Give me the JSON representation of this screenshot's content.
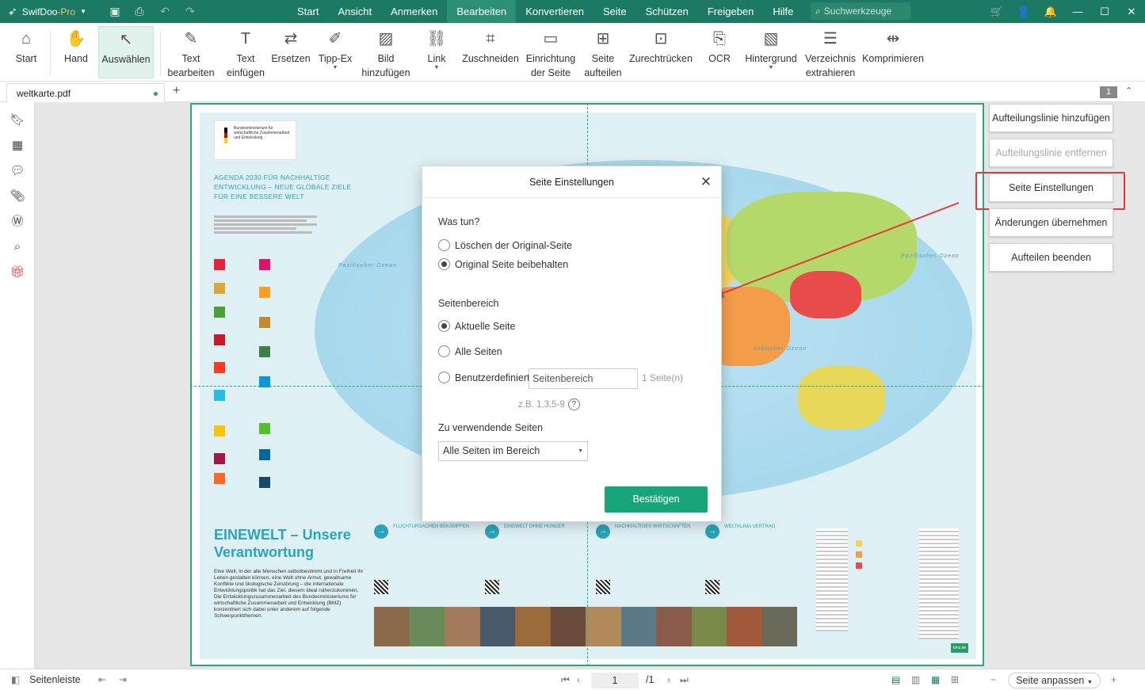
{
  "app": {
    "name": "SwifDoo",
    "suffix": "-Pro"
  },
  "menu": [
    "Start",
    "Ansicht",
    "Anmerken",
    "Bearbeiten",
    "Konvertieren",
    "Seite",
    "Schützen",
    "Freigeben",
    "Hilfe"
  ],
  "menu_active": "Bearbeiten",
  "search_placeholder": "Suchwerkzeuge",
  "ribbon": {
    "start": "Start",
    "hand": "Hand",
    "select": "Auswählen",
    "edit_text_1": "Text",
    "edit_text_2": "bearbeiten",
    "add_text_1": "Text",
    "add_text_2": "einfügen",
    "replace": "Ersetzen",
    "tippex": "Tipp-Ex",
    "add_image_1": "Bild",
    "add_image_2": "hinzufügen",
    "link": "Link",
    "crop": "Zuschneiden",
    "page_setup_1": "Einrichtung",
    "page_setup_2": "der Seite",
    "split_page_1": "Seite",
    "split_page_2": "aufteilen",
    "deskew": "Zurechtrücken",
    "ocr": "OCR",
    "background": "Hintergrund",
    "extract_dir_1": "Verzeichnis",
    "extract_dir_2": "extrahieren",
    "compress": "Komprimieren"
  },
  "tab": {
    "filename": "weltkarte.pdf",
    "page_badge": "1"
  },
  "poster": {
    "gov": "Bundesministerium für wirtschaftliche Zusammenarbeit und Entwicklung",
    "agenda_1": "AGENDA 2030 FÜR NACHHALTIGE",
    "agenda_2": "ENTWICKLUNG – NEUE GLOBALE ZIELE",
    "agenda_3": "FÜR EINE BESSERE WELT",
    "title_1": "EINEWELT – Unsere",
    "title_2": "Verantwortung",
    "body": "Eine Welt, in der alle Menschen selbstbestimmt und in Freiheit ihr Leben gestalten können, eine Welt ohne Armut, gewaltsame Konflikte und ökologische Zerstörung – die internationale Entwicklungspolitik hat das Ziel, diesem Ideal näherzukommen. Die Entwicklungszusammenarbeit des Bundesministeriums für wirtschaftliche Zusammenarbeit und Entwicklung (BMZ) konzentriert sich dabei unter anderem auf folgende Schwerpunktthemen:",
    "col1": "FLUCHTURSACHEN BEKÄMPFEN",
    "col2": "EINEWELT OHNE HUNGER",
    "col3": "NACHHALTIGES WIRTSCHAFTEN",
    "col4": "WELTKLIMA VERTRAG",
    "ocean_pacific": "Pazifischer Ozean",
    "ocean_indian": "Indischer Ozean",
    "bmz": "bmz.de"
  },
  "dialog": {
    "title": "Seite Einstellungen",
    "what_label": "Was tun?",
    "opt_delete": "Löschen der Original-Seite",
    "opt_keep": "Original Seite beibehalten",
    "range_label": "Seitenbereich",
    "opt_current": "Aktuelle Seite",
    "opt_all": "Alle Seiten",
    "opt_custom": "Benutzerdefiniert",
    "range_placeholder": "Seitenbereich",
    "page_count": "1 Seite(n)",
    "example": "z.B. 1,3,5-9",
    "use_pages_label": "Zu verwendende Seiten",
    "use_pages_value": "Alle Seiten im Bereich",
    "confirm": "Bestätigen"
  },
  "right_panel": {
    "add_line": "Aufteilungslinie hinzufügen",
    "remove_line": "Aufteilungslinie entfernen",
    "page_settings": "Seite Einstellungen",
    "apply": "Änderungen übernehmen",
    "finish": "Aufteilen beenden"
  },
  "status": {
    "sidebar": "Seitenleiste",
    "page": "1",
    "total": "/1",
    "fit": "Seite anpassen"
  },
  "colors": {
    "accent": "#1c7a64",
    "confirm": "#18a679",
    "highlight": "#e53935",
    "guide": "#29a783"
  }
}
